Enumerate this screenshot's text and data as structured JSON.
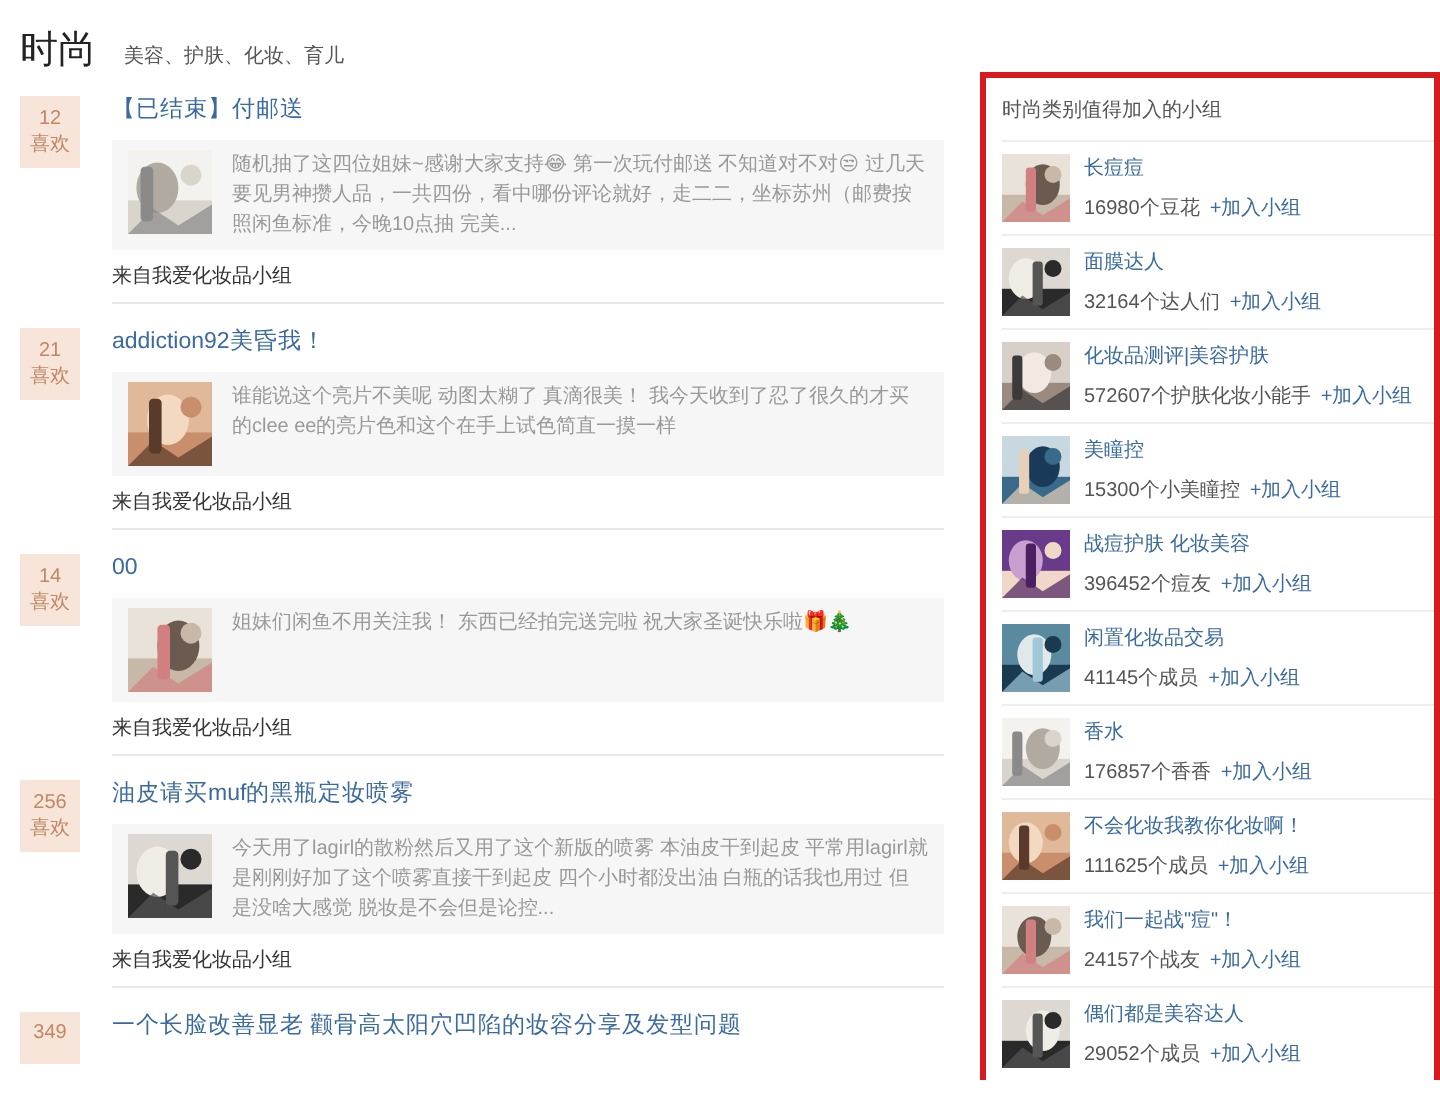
{
  "header": {
    "title": "时尚",
    "tags": "美容、护肤、化妆、育儿"
  },
  "posts": [
    {
      "likes": "12",
      "like_label": "喜欢",
      "title": "【已结束】付邮送",
      "excerpt": "随机抽了这四位姐妹~感谢大家支持😂 第一次玩付邮送 不知道对不对😒 过几天要见男神攒人品，一共四份，看中哪份评论就好，走二二，坐标苏州（邮费按照闲鱼标准，今晚10点抽 完美...",
      "source": "来自我爱化妆品小组"
    },
    {
      "likes": "21",
      "like_label": "喜欢",
      "title": "addiction92美昏我！",
      "excerpt": "谁能说这个亮片不美呢 动图太糊了 真滴很美！ 我今天收到了忍了很久的才买的clee ee的亮片色和这个在手上试色简直一摸一样",
      "source": "来自我爱化妆品小组"
    },
    {
      "likes": "14",
      "like_label": "喜欢",
      "title": "00",
      "excerpt": "姐妹们闲鱼不用关注我！ 东西已经拍完送完啦 祝大家圣诞快乐啦🎁🎄",
      "source": "来自我爱化妆品小组"
    },
    {
      "likes": "256",
      "like_label": "喜欢",
      "title": "油皮请买muf的黑瓶定妆喷雾",
      "excerpt": "今天用了lagirl的散粉然后又用了这个新版的喷雾 本油皮干到起皮 平常用lagirl就是刚刚好加了这个喷雾直接干到起皮 四个小时都没出油 白瓶的话我也用过 但是没啥大感觉 脱妆是不会但是论控...",
      "source": "来自我爱化妆品小组"
    },
    {
      "likes": "349",
      "title": "一个长脸改善显老 颧骨高太阳穴凹陷的妆容分享及发型问题"
    }
  ],
  "sidebar": {
    "title": "时尚类别值得加入的小组",
    "groups": [
      {
        "name": "长痘痘",
        "members": "16980个豆花",
        "join": "+加入小组"
      },
      {
        "name": "面膜达人",
        "members": "32164个达人们",
        "join": "+加入小组"
      },
      {
        "name": "化妆品测评|美容护肤",
        "members": "572607个护肤化妆小能手",
        "join": "+加入小组"
      },
      {
        "name": "美瞳控",
        "members": "15300个小美瞳控",
        "join": "+加入小组"
      },
      {
        "name": "战痘护肤 化妆美容",
        "members": "396452个痘友",
        "join": "+加入小组"
      },
      {
        "name": "闲置化妆品交易",
        "members": "41145个成员",
        "join": "+加入小组"
      },
      {
        "name": "香水",
        "members": "176857个香香",
        "join": "+加入小组"
      },
      {
        "name": "不会化妆我教你化妆啊！",
        "members": "111625个成员",
        "join": "+加入小组"
      },
      {
        "name": "我们一起战\"痘\"！",
        "members": "24157个战友",
        "join": "+加入小组"
      },
      {
        "name": "偶们都是美容达人",
        "members": "29052个成员",
        "join": "+加入小组"
      }
    ]
  }
}
